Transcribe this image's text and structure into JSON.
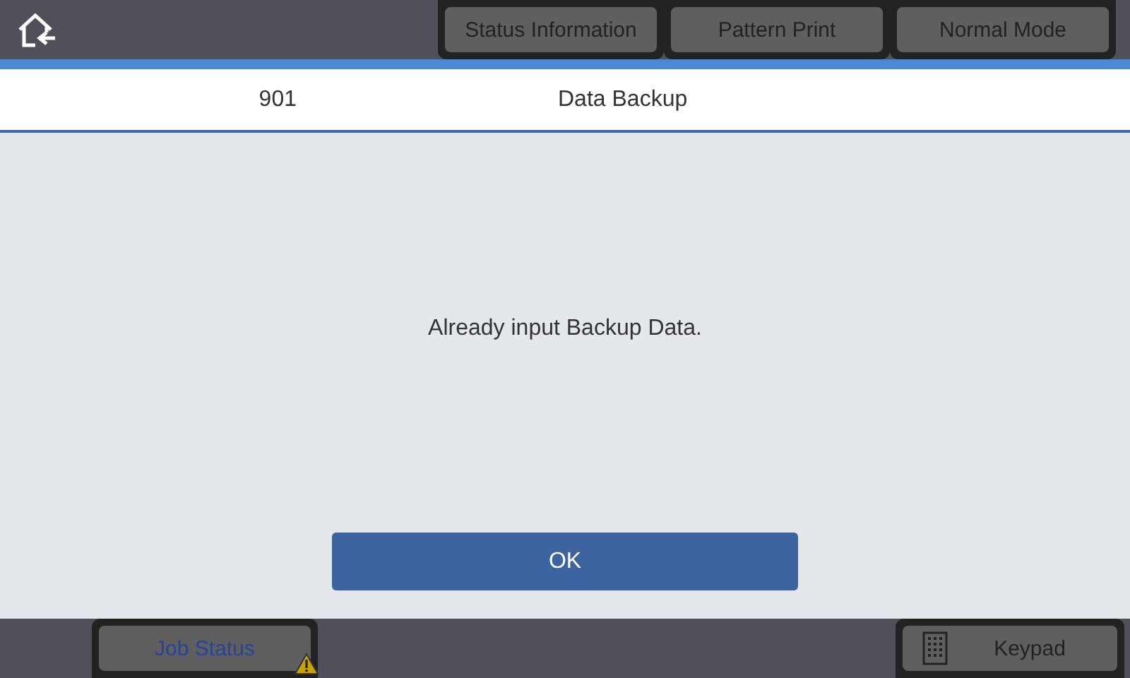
{
  "top_buttons": [
    {
      "label": "Status Information"
    },
    {
      "label": "Pattern Print"
    },
    {
      "label": "Normal Mode"
    }
  ],
  "header": {
    "code": "901",
    "title": "Data Backup"
  },
  "message": "Already input Backup Data.",
  "ok_button": "OK",
  "bottom": {
    "job_status": {
      "label": "Job Status",
      "warning": true
    },
    "keypad": {
      "label": "Keypad"
    }
  }
}
